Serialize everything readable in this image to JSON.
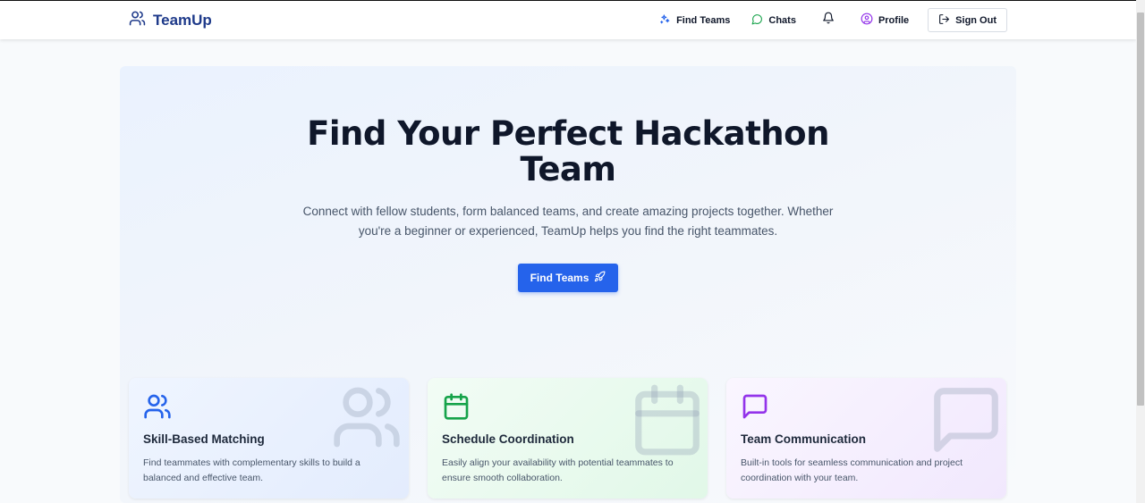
{
  "app": {
    "name": "TeamUp"
  },
  "nav": {
    "items": [
      {
        "label": "Find Teams",
        "icon": "sparkles-icon"
      },
      {
        "label": "Chats",
        "icon": "chat-bubble-icon"
      },
      {
        "label": "",
        "icon": "bell-icon"
      },
      {
        "label": "Profile",
        "icon": "user-circle-icon"
      }
    ],
    "sign_out": "Sign Out"
  },
  "hero": {
    "title_line1": "Find Your Perfect Hackathon",
    "title_line2": "Team",
    "subtitle_line1": "Connect with fellow students, form balanced teams, and create amazing projects together. Whether",
    "subtitle_line2": "you're a beginner or experienced, TeamUp helps you find the right teammates.",
    "cta_label": "Find Teams",
    "cta_icon": "rocket-icon"
  },
  "features": [
    {
      "title": "Skill-Based Matching",
      "desc_line1": "Find teammates with complementary skills to build a",
      "desc_line2": "balanced and effective team.",
      "icon": "users-icon",
      "color": "#2563eb"
    },
    {
      "title": "Schedule Coordination",
      "desc_line1": "Easily align your availability with potential teammates to",
      "desc_line2": "ensure smooth collaboration.",
      "icon": "calendar-icon",
      "color": "#16a34a"
    },
    {
      "title": "Team Communication",
      "desc_line1": "Built-in tools for seamless communication and project",
      "desc_line2": "coordination with your team.",
      "icon": "message-square-icon",
      "color": "#9333ea"
    }
  ],
  "colors": {
    "brand": "#1e3a8a",
    "primary": "#2563eb",
    "text": "#0f172a",
    "muted": "#475569"
  }
}
